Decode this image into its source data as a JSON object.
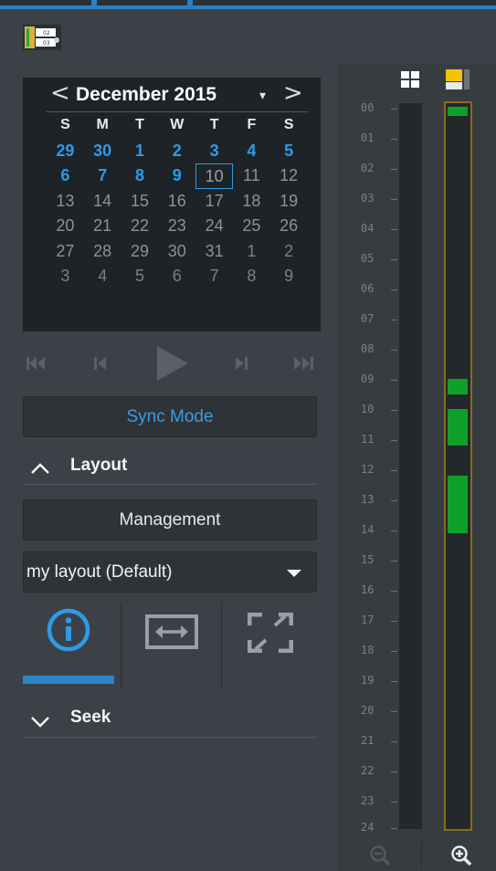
{
  "calendar": {
    "month_label": "December 2015",
    "prev_icon": "<",
    "next_icon": ">",
    "caret": "▾",
    "weekdays": [
      "S",
      "M",
      "T",
      "W",
      "T",
      "F",
      "S"
    ],
    "weeks": [
      [
        "29",
        "30",
        "1",
        "2",
        "3",
        "4",
        "5"
      ],
      [
        "6",
        "7",
        "8",
        "9",
        "10",
        "11",
        "12"
      ],
      [
        "13",
        "14",
        "15",
        "16",
        "17",
        "18",
        "19"
      ],
      [
        "20",
        "21",
        "22",
        "23",
        "24",
        "25",
        "26"
      ],
      [
        "27",
        "28",
        "29",
        "30",
        "31",
        "1",
        "2"
      ],
      [
        "3",
        "4",
        "5",
        "6",
        "7",
        "8",
        "9"
      ]
    ],
    "selected_day": "10"
  },
  "buttons": {
    "sync_mode": "Sync Mode",
    "management": "Management"
  },
  "layout_section": {
    "title": "Layout",
    "selected_layout": "my layout (Default)"
  },
  "seek_section": {
    "title": "Seek"
  },
  "icons": {
    "app": "app-icon",
    "info": "info-icon",
    "fit": "fit-width-icon",
    "fullscreen": "fullscreen-icon",
    "grid_view": "grid-view-icon",
    "marker": "marker-icon",
    "zoom_out": "zoom-out-icon",
    "zoom_in": "zoom-in-icon"
  },
  "timeline": {
    "hours": [
      "00",
      "01",
      "02",
      "03",
      "04",
      "05",
      "06",
      "07",
      "08",
      "09",
      "10",
      "11",
      "12",
      "13",
      "14",
      "15",
      "16",
      "17",
      "18",
      "19",
      "20",
      "21",
      "22",
      "23",
      "24"
    ],
    "recording_hours": [
      [
        0.05,
        0.35
      ],
      [
        9.1,
        9.6
      ],
      [
        10.1,
        11.3
      ],
      [
        12.3,
        14.2
      ]
    ]
  },
  "colors": {
    "accent": "#2d9be6",
    "recording": "#0fa02a",
    "selection_border": "#8a6d12",
    "marker": "#f4c400"
  }
}
